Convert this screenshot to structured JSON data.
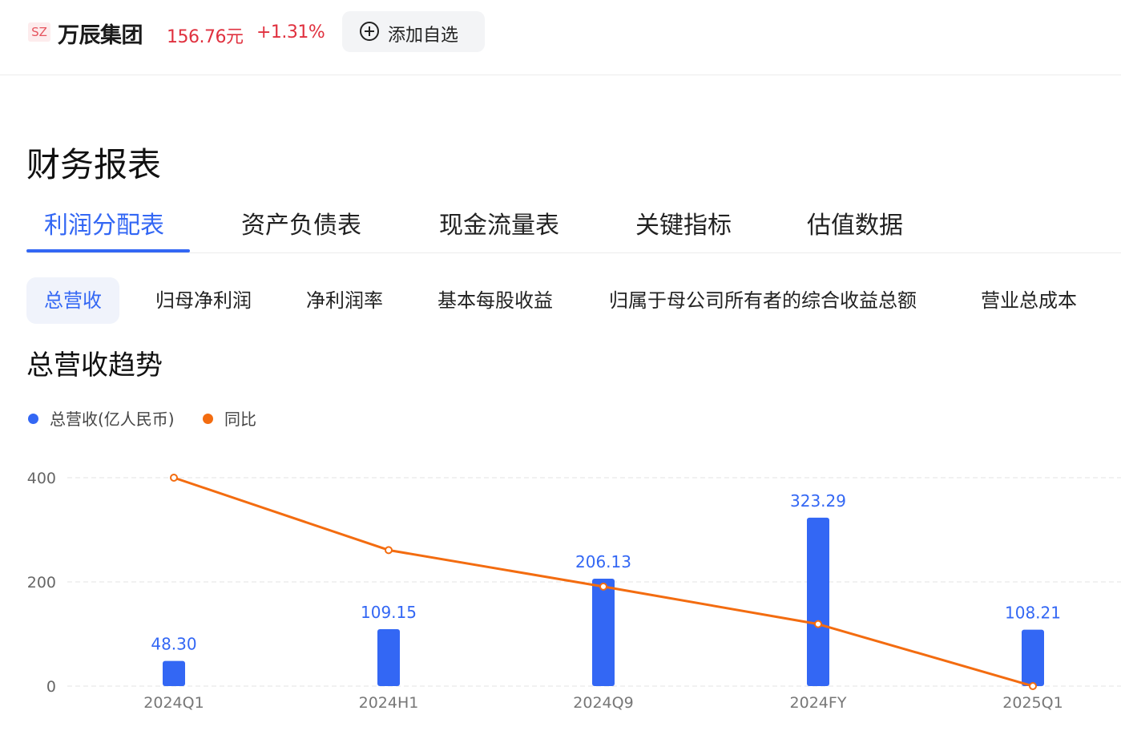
{
  "header": {
    "market": "SZ",
    "name": "万辰集团",
    "price": "156.76元",
    "change": "+1.31%",
    "watch_button": "添加自选"
  },
  "section_title": "财务报表",
  "tabs": [
    {
      "label": "利润分配表",
      "active": true
    },
    {
      "label": "资产负债表",
      "active": false
    },
    {
      "label": "现金流量表",
      "active": false
    },
    {
      "label": "关键指标",
      "active": false
    },
    {
      "label": "估值数据",
      "active": false
    }
  ],
  "subtabs": [
    {
      "label": "总营收",
      "active": true
    },
    {
      "label": "归母净利润",
      "active": false
    },
    {
      "label": "净利润率",
      "active": false
    },
    {
      "label": "基本每股收益",
      "active": false
    },
    {
      "label": "归属于母公司所有者的综合收益总额",
      "active": false
    },
    {
      "label": "营业总成本",
      "active": false
    }
  ],
  "chart_title": "总营收趋势",
  "legend": [
    {
      "label": "总营收(亿人民币)",
      "color": "#3367f4"
    },
    {
      "label": "同比",
      "color": "#f36c10"
    }
  ],
  "chart_data": {
    "type": "bar",
    "categories": [
      "2024Q1",
      "2024H1",
      "2024Q9",
      "2024FY",
      "2025Q1"
    ],
    "series": [
      {
        "name": "总营收(亿人民币)",
        "type": "bar",
        "values": [
          48.3,
          109.15,
          206.13,
          323.29,
          108.21
        ],
        "labels": [
          "48.30",
          "109.15",
          "206.13",
          "323.29",
          "108.21"
        ],
        "color": "#3367f4"
      },
      {
        "name": "同比",
        "type": "line",
        "values": [
          400,
          261,
          191,
          119,
          0
        ],
        "color": "#f36c10"
      }
    ],
    "yticks": [
      "400",
      "200",
      "0"
    ],
    "ylim": [
      0,
      400
    ],
    "grid": true,
    "legend_position": "top-left"
  }
}
